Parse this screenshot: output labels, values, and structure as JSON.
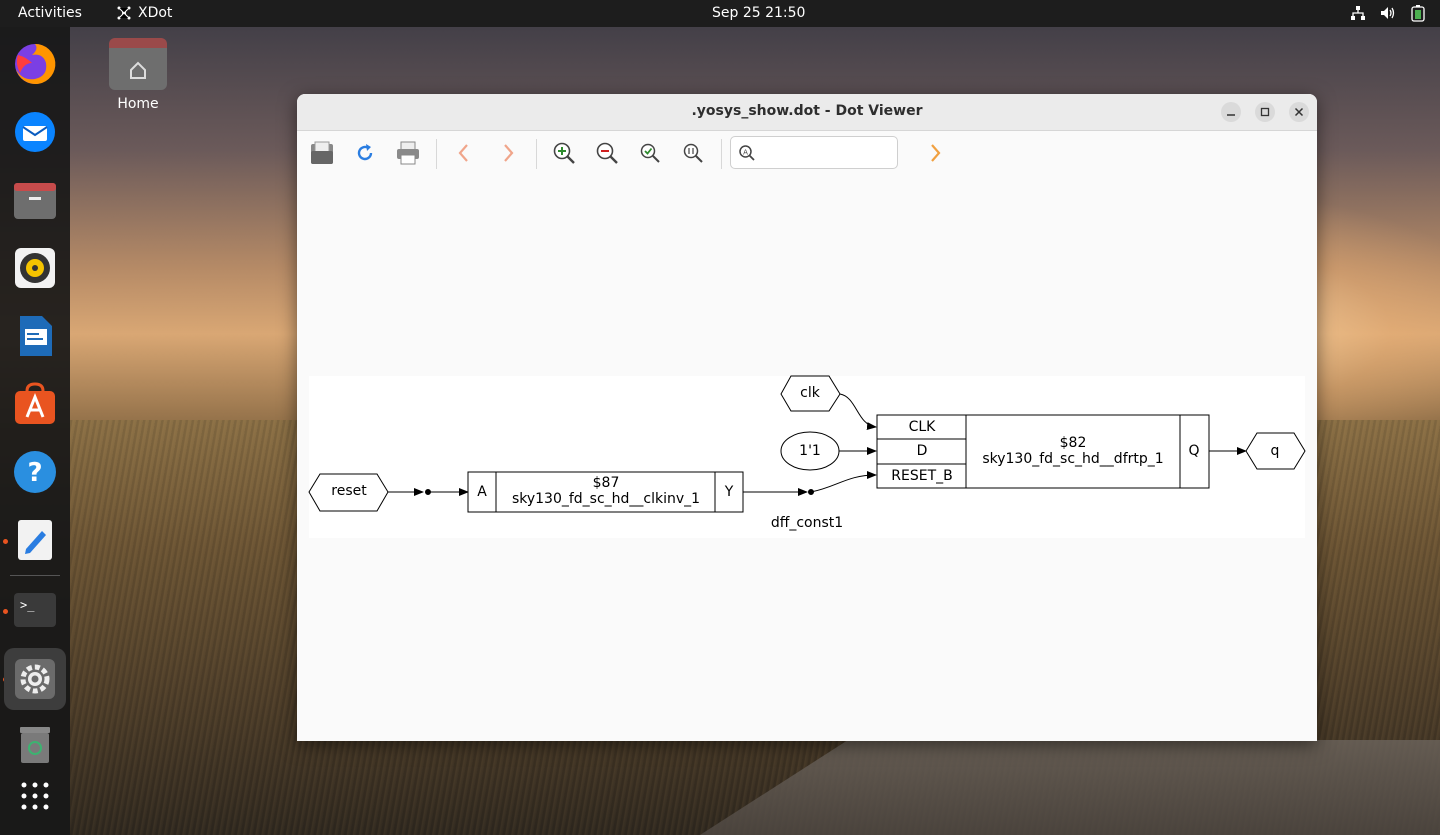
{
  "topbar": {
    "activities": "Activities",
    "app_name": "XDot",
    "clock": "Sep 25  21:50"
  },
  "desktop": {
    "home_label": "Home"
  },
  "dock": {
    "items": [
      "firefox-icon",
      "thunderbird-icon",
      "files-icon",
      "rhythmbox-icon",
      "libreoffice-writer-icon",
      "app-center-icon",
      "help-icon",
      "text-editor-icon",
      "terminal-icon",
      "settings-icon",
      "trash-icon",
      "show-apps-icon"
    ]
  },
  "window": {
    "title": ".yosys_show.dot - Dot Viewer",
    "search_placeholder": ""
  },
  "graph": {
    "nodes": {
      "reset": "reset",
      "clk": "clk",
      "const": "1'1",
      "q": "q",
      "inv_port_a": "A",
      "inv_id": "$87",
      "inv_cell": "sky130_fd_sc_hd__clkinv_1",
      "inv_port_y": "Y",
      "dff_port_clk": "CLK",
      "dff_port_d": "D",
      "dff_port_reset": "RESET_B",
      "dff_id": "$82",
      "dff_cell": "sky130_fd_sc_hd__dfrtp_1",
      "dff_port_q": "Q",
      "wire_label": "dff_const1"
    }
  }
}
